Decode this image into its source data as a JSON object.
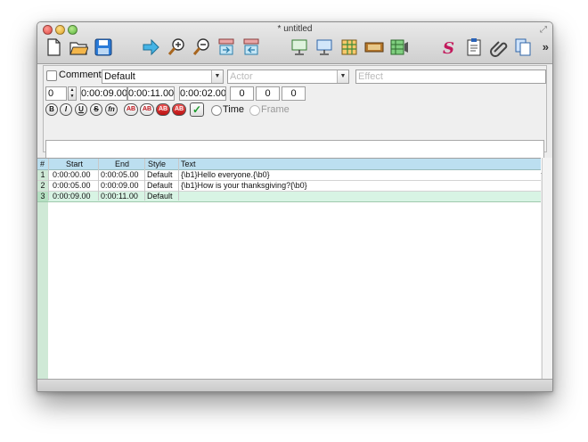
{
  "window": {
    "title": "* untitled"
  },
  "toolbar": {
    "items": [
      "new-file-icon",
      "open-folder-icon",
      "save-icon",
      "jump-to-arrow-icon",
      "zoom-in-icon",
      "zoom-out-icon",
      "video-snap-start-icon",
      "video-snap-end-icon",
      "subtitles-monitor-icon",
      "video-monitor-icon",
      "grid-table-icon",
      "film-strip-icon",
      "video-grid-icon",
      "style-manager-icon",
      "notes-clipboard-icon",
      "attachments-paperclip-icon",
      "copy-pages-icon"
    ],
    "overflow": "»"
  },
  "edit": {
    "comment_label": "Comment",
    "style_value": "Default",
    "actor_placeholder": "Actor",
    "effect_placeholder": "Effect",
    "layer_value": "0",
    "start_time": "0:00:09.00",
    "end_time": "0:00:11.00",
    "duration": "0:00:02.00",
    "margin_left": "0",
    "margin_right": "0",
    "margin_vertical": "0",
    "bold_label": "B",
    "italic_label": "I",
    "underline_label": "U",
    "strike_label": "S",
    "font_label": "fn",
    "color_labels": [
      "AB",
      "AB",
      "AB",
      "AB"
    ],
    "commit_label": "✓",
    "time_label": "Time",
    "frame_label": "Frame"
  },
  "grid": {
    "headers": {
      "num": "#",
      "start": "Start",
      "end": "End",
      "style": "Style",
      "text": "Text"
    },
    "rows": [
      {
        "num": "1",
        "start": "0:00:00.00",
        "end": "0:00:05.00",
        "style": "Default",
        "text": "{\\b1}Hello everyone.{\\b0}"
      },
      {
        "num": "2",
        "start": "0:00:05.00",
        "end": "0:00:09.00",
        "style": "Default",
        "text": "{\\b1}How is your thanksgiving?{\\b0}"
      },
      {
        "num": "3",
        "start": "0:00:09.00",
        "end": "0:00:11.00",
        "style": "Default",
        "text": ""
      }
    ],
    "active_row": 3
  },
  "colors": {
    "header_bg": "#bcdff0",
    "rownum_bg": "#cfe9d6",
    "active_row_bg": "#d8f4e4",
    "ab_red": "#c0131b"
  }
}
